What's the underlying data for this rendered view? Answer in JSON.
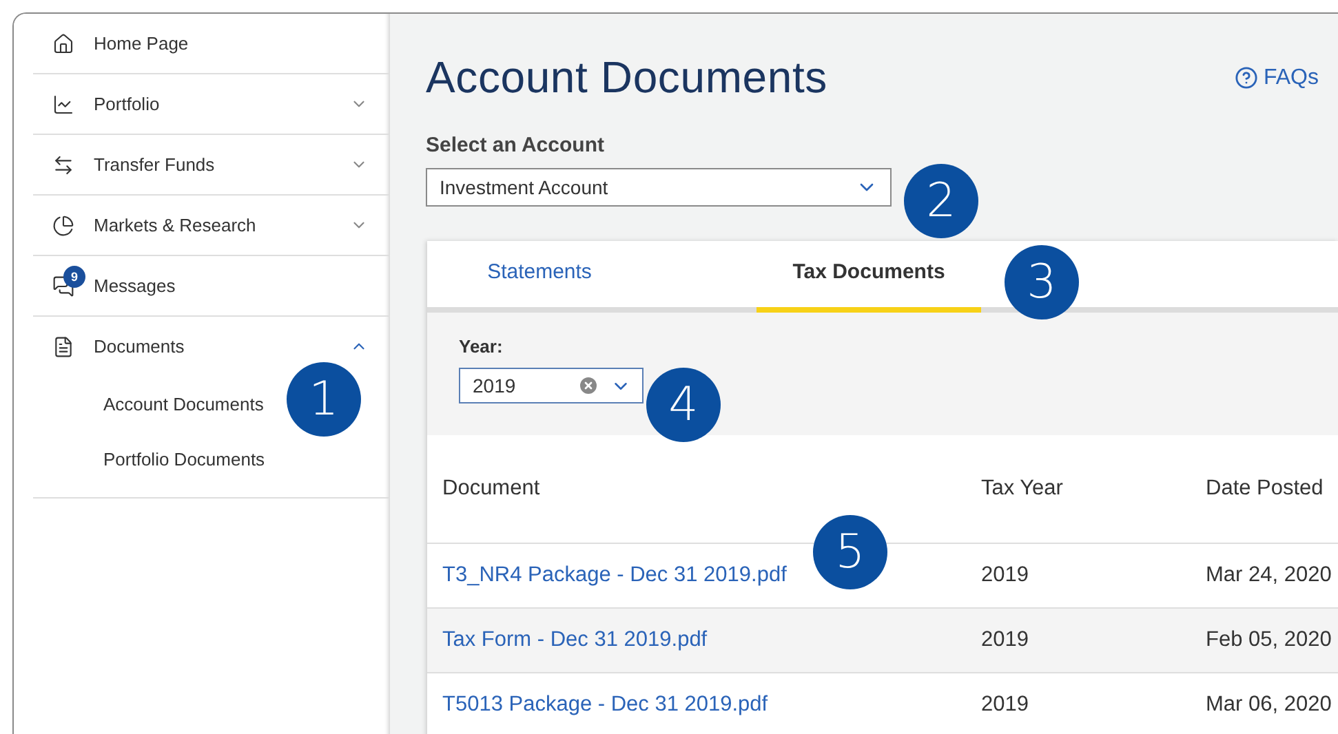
{
  "sidebar": {
    "items": [
      {
        "label": "Home Page"
      },
      {
        "label": "Portfolio",
        "expanded": false
      },
      {
        "label": "Transfer Funds",
        "expanded": false
      },
      {
        "label": "Markets & Research",
        "expanded": false
      },
      {
        "label": "Messages",
        "badge": "9"
      },
      {
        "label": "Documents",
        "expanded": true,
        "children": [
          {
            "label": "Account Documents"
          },
          {
            "label": "Portfolio Documents"
          }
        ]
      }
    ]
  },
  "page": {
    "title": "Account Documents",
    "help_link": "FAQs"
  },
  "account_select": {
    "label": "Select an Account",
    "value": "Investment Account"
  },
  "tabs": [
    {
      "label": "Statements",
      "selected": false
    },
    {
      "label": "Tax Documents",
      "selected": true
    }
  ],
  "year_filter": {
    "label": "Year:",
    "value": "2019"
  },
  "table": {
    "columns": [
      "Document",
      "Tax Year",
      "Date Posted"
    ],
    "rows": [
      [
        "T3_NR4 Package - Dec 31 2019.pdf",
        "2019",
        "Mar 24, 2020"
      ],
      [
        "Tax Form - Dec 31 2019.pdf",
        "2019",
        "Feb 05, 2020"
      ],
      [
        "T5013 Package - Dec 31 2019.pdf",
        "2019",
        "Mar 06, 2020"
      ]
    ]
  },
  "callouts": [
    {
      "label": "1"
    },
    {
      "label": "2"
    },
    {
      "label": "3"
    },
    {
      "label": "4"
    },
    {
      "label": "5"
    }
  ]
}
